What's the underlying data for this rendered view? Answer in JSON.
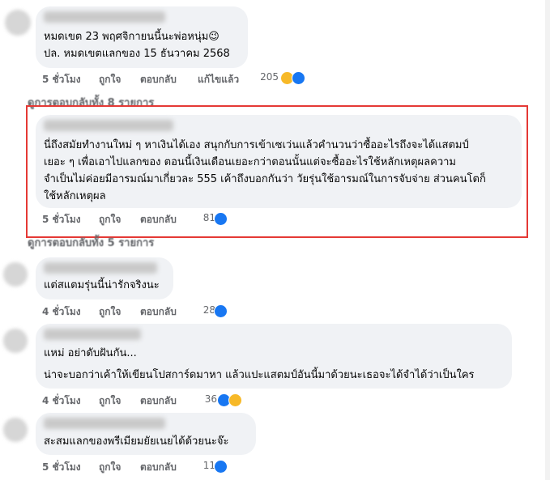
{
  "comments": [
    {
      "lines": [
        "หมดเขต 23 พฤศจิกายนนี้นะพ่อหนุ่ม😉",
        "ปล. หมดเขตแลกของ 15 ธันวาคม 2568"
      ],
      "time": "5 ชั่วโมง",
      "like": "ถูกใจ",
      "reply": "ตอบกลับ",
      "edited": "แก้ไขแล้ว",
      "reaction_count": "205",
      "reactions": [
        "haha-icon",
        "like-icon"
      ]
    },
    {
      "lines": [
        "นี่ถึงสมัยทำงานใหม่ ๆ หาเงินได้เอง สนุกกับการเข้าเซเว่นแล้วคำนวนว่าซื้ออะไรถึงจะได้แสตมป์",
        "เยอะ ๆ เพื่อเอาไปแลกของ ตอนนี้เงินเดือนเยอะกว่าตอนนั้นแต่จะซื้ออะไรใช้หลักเหตุผลความ",
        "จำเป็นไม่ค่อยมีอารมณ์มาเกี่ยวละ 555 เค้าถึงบอกกันว่า วัยรุ่นใช้อารมณ์ในการจับจ่าย ส่วนคนโตก็",
        "ใช้หลักเหตุผล"
      ],
      "time": "5 ชั่วโมง",
      "like": "ถูกใจ",
      "reply": "ตอบกลับ",
      "reaction_count": "81",
      "reactions": [
        "like-icon"
      ]
    },
    {
      "lines": [
        "แต่สแตมรุ่นนี้น่ารักจริงนะ"
      ],
      "time": "4 ชั่วโมง",
      "like": "ถูกใจ",
      "reply": "ตอบกลับ",
      "reaction_count": "28",
      "reactions": [
        "like-icon"
      ]
    },
    {
      "lines": [
        "แหม่ อย่าดับฝันกัน...",
        "น่าจะบอกว่าเค้าให้เขียนโปสการ์ดมาหา แล้วแปะแสตมป์อันนี้มาด้วยนะเธอจะได้จำได้ว่าเป็นใคร"
      ],
      "time": "4 ชั่วโมง",
      "like": "ถูกใจ",
      "reply": "ตอบกลับ",
      "reaction_count": "36",
      "reactions": [
        "like-icon",
        "haha-icon"
      ]
    },
    {
      "lines": [
        "สะสมแลกของพรีเมียมยัยเนยได้ด้วยนะจ๊ะ"
      ],
      "time": "5 ชั่วโมง",
      "like": "ถูกใจ",
      "reply": "ตอบกลับ",
      "reaction_count": "11",
      "reactions": [
        "like-icon"
      ]
    }
  ],
  "more_replies": [
    "ดูการตอบกลับทั้ง 8 รายการ",
    "ดูการตอบกลับทั้ง 5 รายการ"
  ],
  "colors": {
    "highlight": "#e53935",
    "like": "#1877f2",
    "haha": "#f7b928",
    "bubble": "#f0f2f5",
    "meta": "#65676b"
  }
}
